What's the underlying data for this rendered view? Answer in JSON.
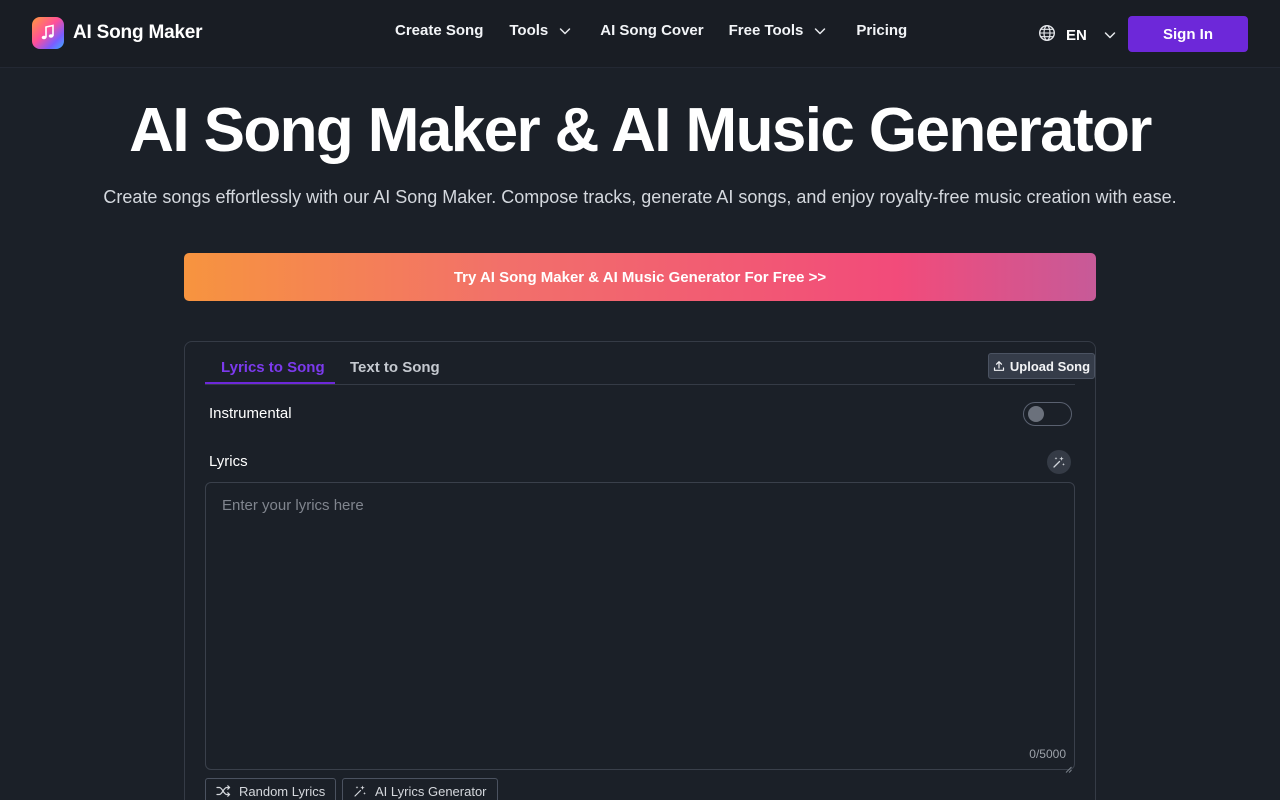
{
  "header": {
    "brand": "AI Song Maker",
    "nav": [
      {
        "label": "Create Song",
        "dropdown": false
      },
      {
        "label": "Tools",
        "dropdown": true
      },
      {
        "label": "AI Song Cover",
        "dropdown": false
      },
      {
        "label": "Free Tools",
        "dropdown": true
      },
      {
        "label": "Pricing",
        "dropdown": false
      }
    ],
    "language": "EN",
    "sign_in": "Sign In"
  },
  "hero": {
    "title": "AI Song Maker & AI Music Generator",
    "subtitle": "Create songs effortlessly with our AI Song Maker. Compose tracks, generate AI songs, and enjoy royalty-free music creation with ease.",
    "cta": "Try AI Song Maker & AI Music Generator For Free >>"
  },
  "form": {
    "tabs": [
      {
        "label": "Lyrics to Song",
        "active": true
      },
      {
        "label": "Text to Song",
        "active": false
      }
    ],
    "upload_label": "Upload Song",
    "instrumental_label": "Instrumental",
    "instrumental_on": false,
    "lyrics_label": "Lyrics",
    "lyrics_placeholder": "Enter your lyrics here",
    "lyrics_value": "",
    "counter": "0/5000",
    "random_lyrics": "Random Lyrics",
    "ai_lyrics_generator": "AI Lyrics Generator"
  },
  "colors": {
    "background": "#1b2028",
    "accent": "#6d28d9",
    "tab_active": "#7c3aed",
    "cta_start": "#f7943f",
    "cta_end": "#c75a98"
  }
}
